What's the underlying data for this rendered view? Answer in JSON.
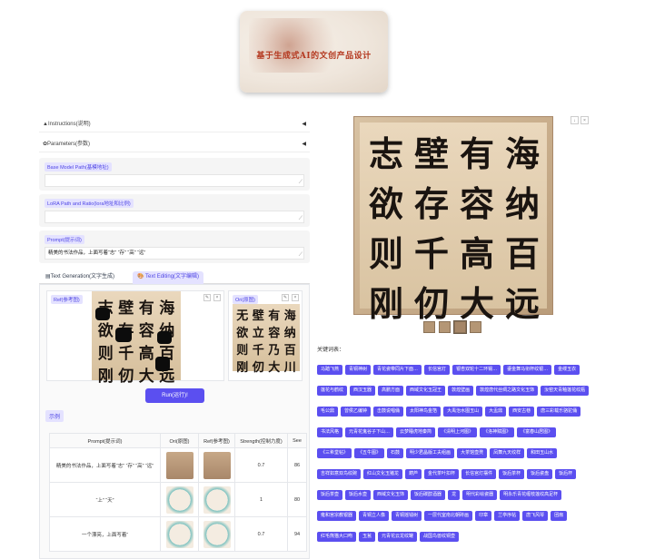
{
  "banner": {
    "title": "基于生成式AI的文创产品设计"
  },
  "accordions": [
    {
      "label": "▲Instructions(说明)"
    },
    {
      "label": "✿Parameters(参数)"
    }
  ],
  "fields": {
    "base_model": {
      "label": "Base Model Path(基模地址)",
      "value": ""
    },
    "lora": {
      "label": "LoRA Path and Ratio(lora地址和比例)",
      "value": ""
    },
    "prompt": {
      "label": "Prompt(提示词)",
      "value": "精美的书法作品，上面写着“志” “存” “高” “远”"
    }
  },
  "tabs": [
    {
      "label": "▤Text Generation(文字生成)"
    },
    {
      "label": "🎨 Text Editing(文字编辑)"
    }
  ],
  "ref_image": {
    "label": "Ref(参考图)",
    "chars": [
      "志",
      "壁",
      "有",
      "海",
      "欲",
      "存",
      "容",
      "纳",
      "则",
      "千",
      "高",
      "百",
      "刚",
      "仞",
      "大",
      "远"
    ]
  },
  "ori_image": {
    "label": "Ori(原图)",
    "chars": [
      "无",
      "壁",
      "有",
      "海",
      "欲",
      "立",
      "容",
      "纳",
      "则",
      "千",
      "乃",
      "百",
      "刚",
      "仞",
      "大",
      "川"
    ]
  },
  "run_button": {
    "label": "Run(运行)!"
  },
  "examples": {
    "label": "示例",
    "columns": [
      "Prompt(提示词)",
      "Ori(原图)",
      "Ref(参考图)",
      "Strength(控制力度)",
      "See"
    ],
    "rows": [
      {
        "prompt": "精美的书法作品，上面写着“志” “存” “高” “远”",
        "strength": "0.7",
        "seed": "86"
      },
      {
        "prompt": "“上” “天”",
        "strength": "1",
        "seed": "80"
      },
      {
        "prompt": "一个漂亮，上面写着“",
        "strength": "0.7",
        "seed": "94"
      }
    ]
  },
  "main_image": {
    "chars": [
      "志",
      "壁",
      "有",
      "海",
      "欲",
      "存",
      "容",
      "纳",
      "则",
      "千",
      "高",
      "百",
      "刚",
      "仞",
      "大",
      "远"
    ]
  },
  "keywords": {
    "title": "关键词表：",
    "items": [
      "马踏飞燕",
      "青铜神树",
      "青花瓷带同片下面…",
      "长信宫灯",
      "银杏双轮十二环锡…",
      "鎏金舞马衔杯纹银…",
      "金缕玉衣",
      "莲花与鹤纹",
      "西汉玉器",
      "高鹏方面",
      "西域文化玉冠王",
      "敦煌壁画",
      "敦煌唐代丝绸之路文化玉饰",
      "汝窑天青釉莲花纹瓶",
      "毛公鼎",
      "曾侯乙编钟",
      "击鼓说唱俑",
      "太阳神鸟金箔",
      "大禹治水图玉山",
      "大盂鼎",
      "西安古巷",
      "唐三彩载乐骆驼俑",
      "书法风格",
      "元青花鬼谷子下山…",
      "云梦睡虎地秦简",
      "《清明上河图》",
      "《洛神赋图》",
      "《富春山居图》",
      "《三希堂帖》",
      "《五牛图》",
      "石鼓",
      "明少君晶版工夫组画",
      "大茶馆壶凳",
      "凤舞九天纹样",
      "和田玉山水",
      "吉祥如意双鸟纹碗",
      "红山文化玉猪龙",
      "葫芦",
      "金代茶叶扣杯",
      "长信宫灯摆件",
      "饭后茶杯",
      "饭后瓷盘",
      "饭后杯",
      "饭后茶壶",
      "饭后水壶",
      "西域文化玉饰",
      "饭后碳醇酒器",
      "龙",
      "明代彩绘瓷器",
      "明永乐青花缠枝莲纹高足杯",
      "雍和宫宗教银器",
      "青铜立人像",
      "青铜摇钱树",
      "一层代室南北朝砖画",
      "印章",
      "兰亭序帖",
      "唐飞风琴",
      "团扇",
      "红毛熊猫大口吻",
      "玉瓮",
      "元青花云龙纹罐",
      "战国鸟兽纹铜壶"
    ]
  }
}
